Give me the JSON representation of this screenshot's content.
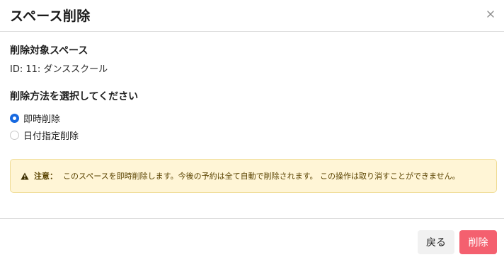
{
  "modal": {
    "title": "スペース削除",
    "close_icon": "close-icon"
  },
  "target": {
    "heading": "削除対象スペース",
    "value": "ID: 11: ダンススクール"
  },
  "method": {
    "heading": "削除方法を選択してください",
    "options": [
      {
        "label": "即時削除",
        "selected": true
      },
      {
        "label": "日付指定削除",
        "selected": false
      }
    ]
  },
  "notice": {
    "icon": "warning-icon",
    "label": "注意：",
    "text": "このスペースを即時削除します。今後の予約は全て自動で削除されます。 この操作は取り消すことができません。",
    "background": "#fff5d6",
    "border": "#f0dc95"
  },
  "footer": {
    "back_label": "戻る",
    "delete_label": "削除",
    "delete_color": "#f4606f"
  },
  "colors": {
    "accent": "#1769e0"
  }
}
